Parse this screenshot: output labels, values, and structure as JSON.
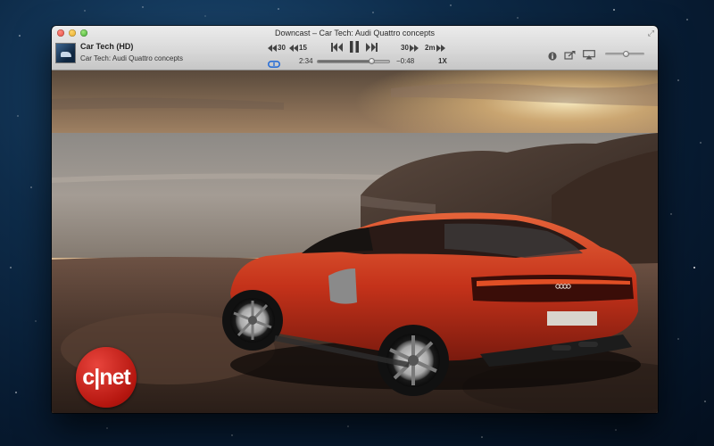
{
  "window": {
    "title": "Downcast – Car Tech: Audi Quattro concepts"
  },
  "now_playing": {
    "podcast": "Car Tech (HD)",
    "episode": "Car Tech: Audi Quattro concepts"
  },
  "controls": {
    "skip_back_long": "30",
    "skip_back_short": "15",
    "skip_forward_short": "30",
    "skip_forward_long": "2m",
    "elapsed": "2:34",
    "remaining": "−0:48",
    "speed": "1X",
    "progress": 0.76,
    "volume": 0.55
  },
  "video": {
    "watermark": "c|net"
  },
  "icons": {
    "loop": "loop-icon",
    "info": "info-icon",
    "share": "share-icon",
    "airplay": "airplay-icon"
  },
  "colors": {
    "accent_blue": "#2b6fd6",
    "car_red": "#c4321a",
    "cnet_red": "#c41e16"
  }
}
